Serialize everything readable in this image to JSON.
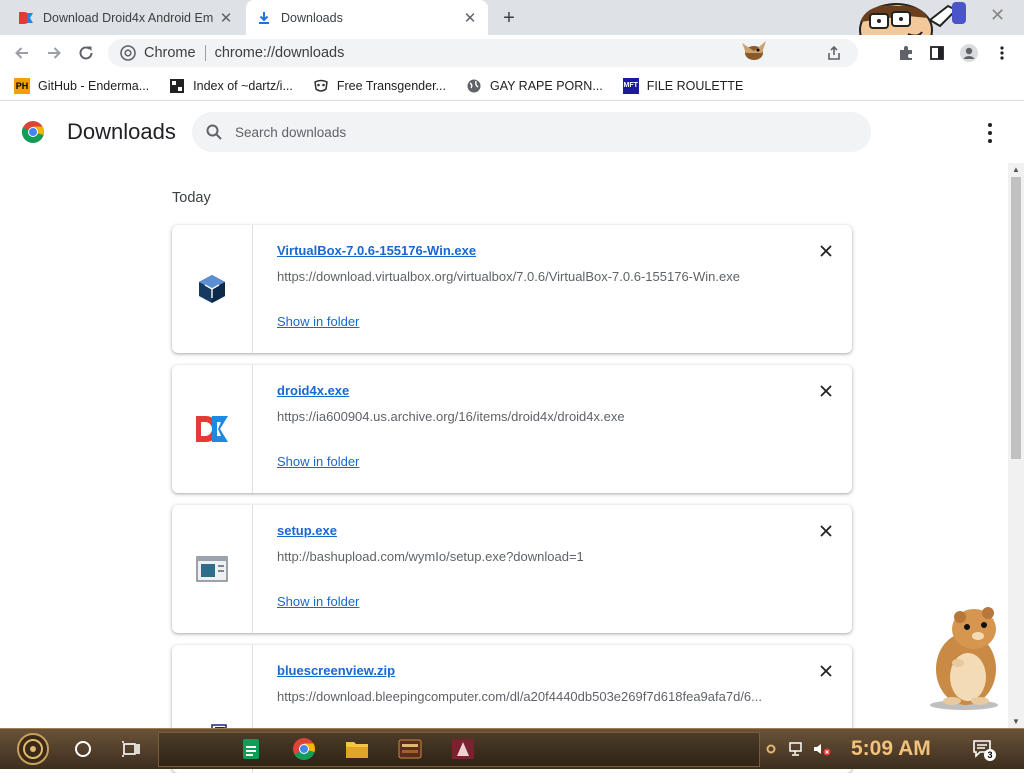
{
  "tabs": [
    {
      "title": "Download Droid4x Android Em",
      "active": false
    },
    {
      "title": "Downloads",
      "active": true
    }
  ],
  "omnibox": {
    "chip": "Chrome",
    "url": "chrome://downloads"
  },
  "bookmarks": [
    {
      "label": "GitHub - Enderma...",
      "icon": "PH"
    },
    {
      "label": "Index of ~dartz/i...",
      "icon": "index-icon"
    },
    {
      "label": "Free Transgender...",
      "icon": "mask-icon"
    },
    {
      "label": "GAY RAPE PORN...",
      "icon": "globe-icon"
    },
    {
      "label": "FILE ROULETTE",
      "icon": "MFT"
    }
  ],
  "page": {
    "title": "Downloads",
    "search_placeholder": "Search downloads",
    "section": "Today"
  },
  "downloads": [
    {
      "name": "VirtualBox-7.0.6-155176-Win.exe",
      "url": "https://download.virtualbox.org/virtualbox/7.0.6/VirtualBox-7.0.6-155176-Win.exe",
      "action": "Show in folder",
      "icon": "virtualbox-icon"
    },
    {
      "name": "droid4x.exe",
      "url": "https://ia600904.us.archive.org/16/items/droid4x/droid4x.exe",
      "action": "Show in folder",
      "icon": "droid4x-icon"
    },
    {
      "name": "setup.exe",
      "url": "http://bashupload.com/wymIo/setup.exe?download=1",
      "action": "Show in folder",
      "icon": "setup-exe-icon"
    },
    {
      "name": "bluescreenview.zip",
      "url": "https://download.bleepingcomputer.com/dl/a20f4440db503e269f7d618fea9afa7d/6...",
      "action": "",
      "icon": "zip-folder-icon"
    }
  ],
  "taskbar": {
    "clock": "5:09 AM",
    "notification_count": "3"
  },
  "colors": {
    "tabstrip": "#dee1e6",
    "link": "#1967d2",
    "taskbar": "#4c3b27",
    "clock": "#f2c27a"
  }
}
